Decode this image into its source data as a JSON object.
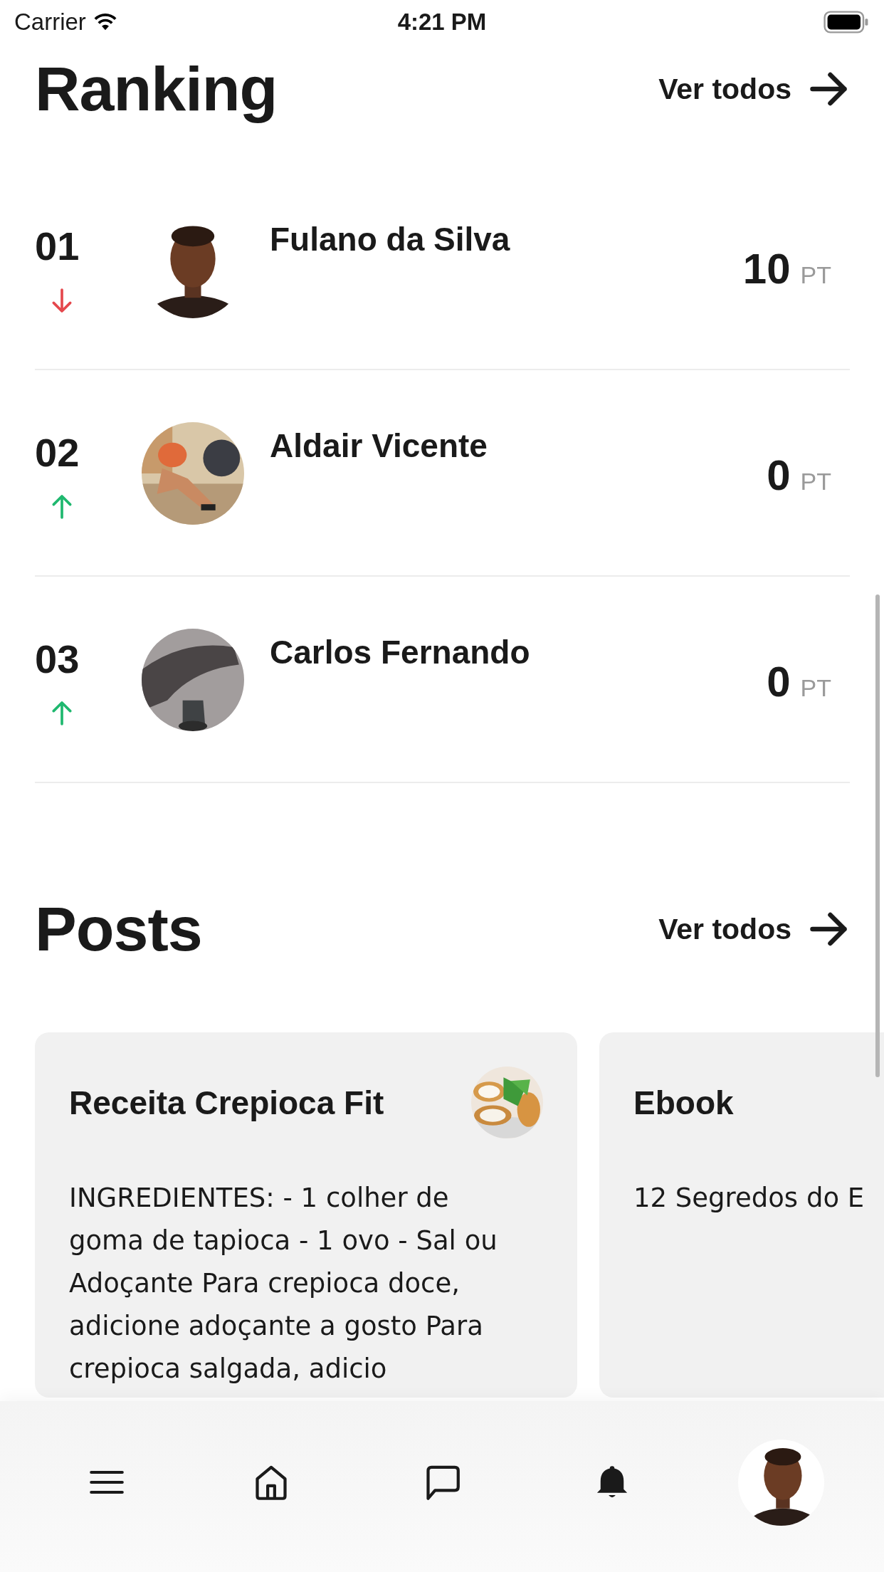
{
  "status_bar": {
    "carrier": "Carrier",
    "time": "4:21 PM"
  },
  "ranking": {
    "title": "Ranking",
    "see_all": "Ver todos",
    "rows": [
      {
        "rank": "01",
        "trend_up": false,
        "name": "Fulano da Silva",
        "points": "10",
        "unit": "PT"
      },
      {
        "rank": "02",
        "trend_up": true,
        "name": "Aldair Vicente",
        "points": "0",
        "unit": "PT"
      },
      {
        "rank": "03",
        "trend_up": true,
        "name": "Carlos Fernando",
        "points": "0",
        "unit": "PT"
      }
    ]
  },
  "posts": {
    "title": "Posts",
    "see_all": "Ver todos",
    "cards": [
      {
        "title": "Receita Crepioca Fit",
        "body": "INGREDIENTES: - 1 colher de goma de tapioca - 1 ovo - Sal ou Adoçante Para crepioca doce, adicione adoçante a gosto Para crepioca salgada, adicio"
      },
      {
        "title": "Ebook",
        "body": "12 Segredos do E"
      }
    ]
  }
}
